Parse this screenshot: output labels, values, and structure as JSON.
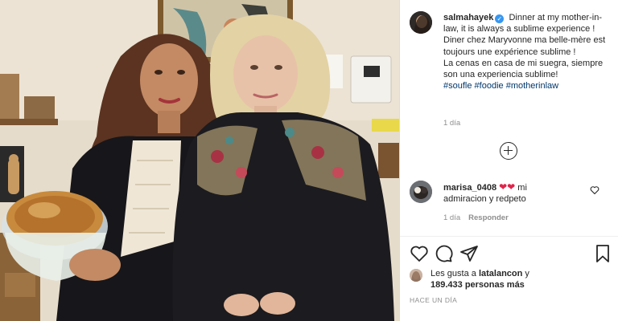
{
  "post": {
    "username": "salmahayek",
    "verified_mark": "✓",
    "caption_lines": [
      "Dinner at my mother-in-law, it is always a sublime experience !",
      "Diner chez Maryvonne ma belle-mère est toujours une expérience sublime !",
      "La cenas en casa de mi suegra, siempre son una experiencia sublime!"
    ],
    "hashtags": [
      "#soufle",
      "#foodie",
      "#motherinlaw"
    ],
    "time": "1 día"
  },
  "load_more_icon": "plus-circle-icon",
  "comment": {
    "username": "marisa_0408",
    "hearts": "❤❤",
    "text": " mi admiracion y redpeto",
    "time": "1 día",
    "reply_label": "Responder"
  },
  "actions": [
    "heart-icon",
    "comment-icon",
    "share-icon",
    "bookmark-icon"
  ],
  "likes": {
    "prefix": "Les gusta a ",
    "user": "latalancon",
    "connector": " y",
    "count": "189.433 personas más"
  },
  "posted_ago": "HACE UN DÍA",
  "colors": {
    "link": "#00376b",
    "verified": "#3897f0",
    "meta": "#8e8e8e",
    "heart": "#e0244a"
  }
}
